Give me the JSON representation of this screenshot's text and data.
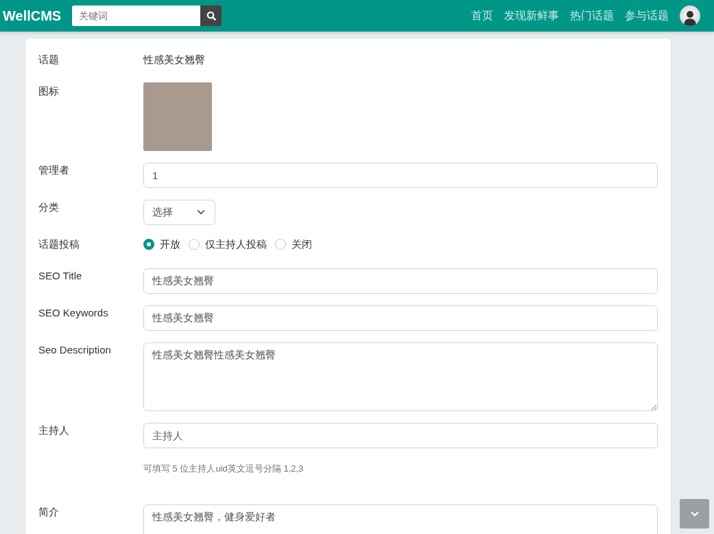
{
  "navbar": {
    "brand": "WellCMS",
    "search": {
      "placeholder": "关键词"
    },
    "links": [
      {
        "label": "首页"
      },
      {
        "label": "发现新鲜事"
      },
      {
        "label": "热门话题"
      },
      {
        "label": "参与话题"
      }
    ]
  },
  "form": [
    {
      "kind": "text",
      "label": "话题",
      "value": "性感美女翘臀"
    },
    {
      "kind": "image",
      "label": "图标"
    },
    {
      "kind": "input",
      "label": "管理者",
      "value": "1"
    },
    {
      "kind": "select",
      "label": "分类",
      "value": "选择"
    },
    {
      "kind": "radio",
      "label": "话题投稿",
      "options": [
        {
          "label": "开放",
          "selected": true
        },
        {
          "label": "仅主持人投稿",
          "selected": false
        },
        {
          "label": "关闭",
          "selected": false
        }
      ]
    },
    {
      "kind": "input",
      "label": "SEO Title",
      "value": "性感美女翘臀"
    },
    {
      "kind": "input",
      "label": "SEO Keywords",
      "value": "性感美女翘臀"
    },
    {
      "kind": "textarea",
      "label": "Seo Description",
      "value": "性感美女翘臀性感美女翘臀"
    },
    {
      "kind": "input",
      "label": "主持人",
      "placeholder": "主持人",
      "help": "可填写 5 位主持人uid英文逗号分隔 1,2,3"
    },
    {
      "kind": "textarea",
      "label": "简介",
      "value": "性感美女翘臀，健身爱好者"
    }
  ]
}
